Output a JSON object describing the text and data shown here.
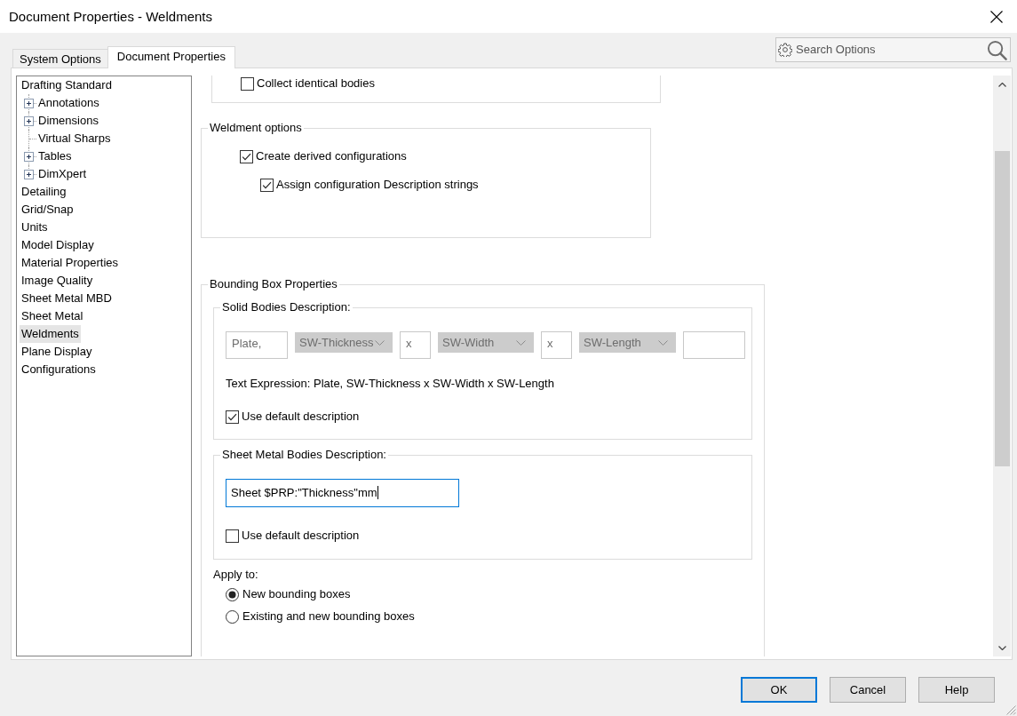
{
  "window": {
    "title": "Document Properties - Weldments"
  },
  "tabs": [
    {
      "label": "System Options",
      "selected": false
    },
    {
      "label": "Document Properties",
      "selected": true
    }
  ],
  "search": {
    "placeholder": "Search Options"
  },
  "tree": [
    {
      "label": "Drafting Standard",
      "selected": false,
      "children": [
        {
          "label": "Annotations",
          "kind": "expandable",
          "expanded": false,
          "selected": false
        },
        {
          "label": "Dimensions",
          "kind": "expandable",
          "expanded": false,
          "selected": false
        },
        {
          "label": "Virtual Sharps",
          "kind": "leaf",
          "selected": false
        },
        {
          "label": "Tables",
          "kind": "expandable",
          "expanded": false,
          "selected": false
        },
        {
          "label": "DimXpert",
          "kind": "expandable",
          "expanded": false,
          "selected": false
        }
      ]
    },
    {
      "label": "Detailing",
      "selected": false
    },
    {
      "label": "Grid/Snap",
      "selected": false
    },
    {
      "label": "Units",
      "selected": false
    },
    {
      "label": "Model Display",
      "selected": false
    },
    {
      "label": "Material Properties",
      "selected": false
    },
    {
      "label": "Image Quality",
      "selected": false
    },
    {
      "label": "Sheet Metal MBD",
      "selected": false
    },
    {
      "label": "Sheet Metal",
      "selected": false
    },
    {
      "label": "Weldments",
      "selected": true
    },
    {
      "label": "Plane Display",
      "selected": false
    },
    {
      "label": "Configurations",
      "selected": false
    }
  ],
  "cut_off_group": {
    "checkboxes": [
      {
        "label": "Collect identical bodies",
        "checked": false
      }
    ]
  },
  "weldment_options": {
    "title": "Weldment options",
    "checkboxes": [
      {
        "label": "Create derived configurations",
        "checked": true,
        "children": [
          {
            "label": "Assign configuration Description strings",
            "checked": true
          }
        ]
      }
    ]
  },
  "bounding_box_properties": {
    "title": "Bounding Box Properties",
    "solid_bodies": {
      "title": "Solid Bodies Description:",
      "fields": [
        {
          "kind": "text",
          "value": "Plate,",
          "disabled": true
        },
        {
          "kind": "dropdown",
          "value": "SW-Thickness",
          "disabled": true
        },
        {
          "kind": "text",
          "value": "x",
          "disabled": true
        },
        {
          "kind": "dropdown",
          "value": "SW-Width",
          "disabled": true
        },
        {
          "kind": "text",
          "value": "x",
          "disabled": true
        },
        {
          "kind": "dropdown",
          "value": "SW-Length",
          "disabled": true
        },
        {
          "kind": "text",
          "disabled": true
        }
      ],
      "text_expression": "Text Expression: Plate, SW-Thickness x SW-Width x SW-Length",
      "use_default": {
        "label": "Use default description",
        "checked": true
      }
    },
    "sheet_metal_bodies": {
      "title": "Sheet Metal Bodies Description:",
      "field": {
        "value": "Sheet $PRP:\"Thickness\"mm",
        "focused": true
      },
      "use_default": {
        "label": "Use default description",
        "checked": false
      }
    },
    "apply_to": {
      "label": "Apply to:",
      "options": [
        {
          "label": "New bounding boxes",
          "selected": true
        },
        {
          "label": "Existing and new bounding boxes",
          "selected": false
        }
      ]
    }
  },
  "buttons": [
    {
      "label": "OK",
      "default": true
    },
    {
      "label": "Cancel",
      "default": false
    },
    {
      "label": "Help",
      "default": false
    }
  ]
}
